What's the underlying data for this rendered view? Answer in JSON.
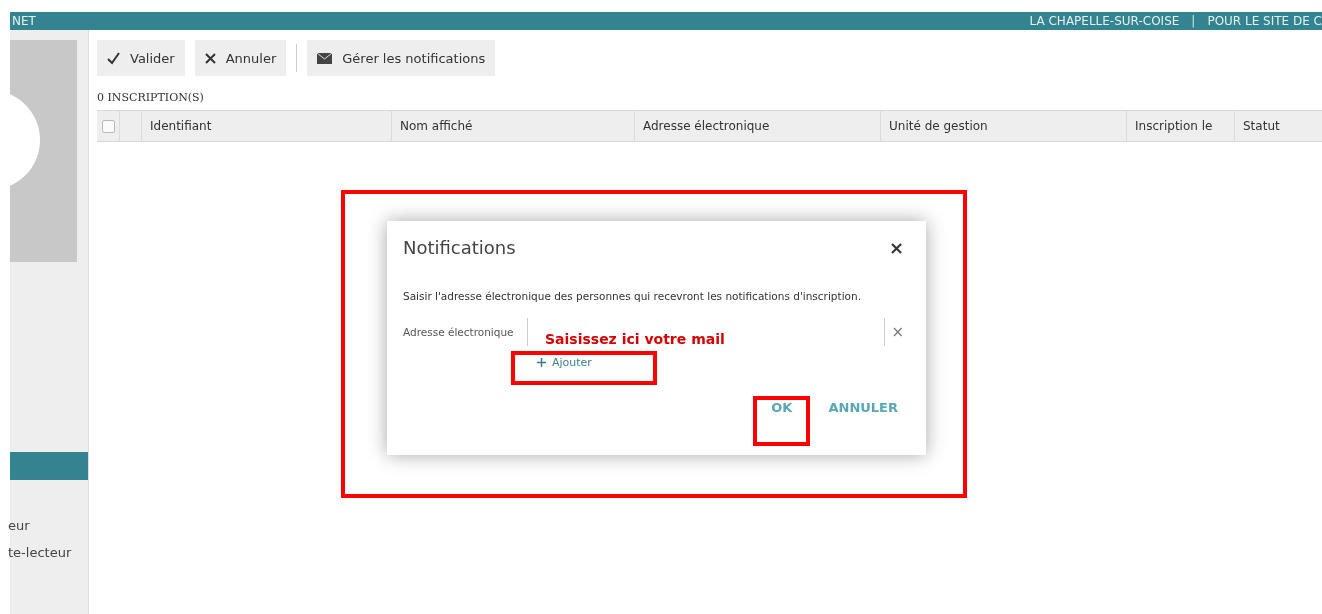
{
  "header": {
    "brand": "NET",
    "links": [
      "LA CHAPELLE-SUR-COISE",
      "POUR LE SITE DE C"
    ],
    "separator": "|"
  },
  "sidebar": {
    "items": [
      {
        "label": "eur"
      },
      {
        "label": "te-lecteur"
      }
    ]
  },
  "toolbar": [
    {
      "kind": "check",
      "label": "Valider"
    },
    {
      "kind": "cross",
      "label": "Annuler"
    },
    {
      "kind": "separator"
    },
    {
      "kind": "mail",
      "label": "Gérer les notifications"
    }
  ],
  "count": "0 INSCRIPTION(S)",
  "table": {
    "select_all": {
      "checked": false
    },
    "columns": [
      "Identifiant",
      "Nom affiché",
      "Adresse électronique",
      "Unité de gestion",
      "Inscription le",
      "Statut"
    ]
  },
  "dialog": {
    "title": "Notifications",
    "close": "×",
    "message": "Saisir l'adresse électronique des personnes qui recevront les notifications d'inscription.",
    "field_label": "Adresse électronique",
    "field_clear": "×",
    "add_label": "Ajouter",
    "buttons": [
      "OK",
      "ANNULER"
    ]
  },
  "annotations": {
    "hint": "Saisissez ici votre mail"
  }
}
